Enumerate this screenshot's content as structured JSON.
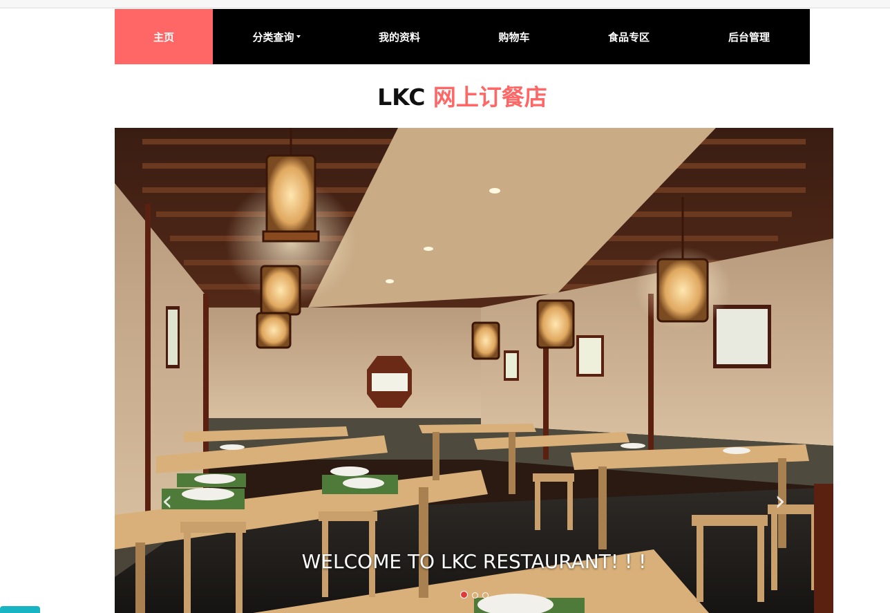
{
  "nav": {
    "items": [
      {
        "label": "主页",
        "active": true
      },
      {
        "label": "分类查询",
        "dropdown": true
      },
      {
        "label": "我的资料"
      },
      {
        "label": "购物车"
      },
      {
        "label": "食品专区"
      },
      {
        "label": "后台管理"
      }
    ],
    "active_color": "#ff6666",
    "bg_color": "#000000"
  },
  "title": {
    "brand": "LKC",
    "name": "网上订餐店",
    "name_color": "#ff6666"
  },
  "carousel": {
    "caption": "WELCOME TO LKC RESTAURANT! ! !",
    "prev_icon": "chevron-left-icon",
    "next_icon": "chevron-right-icon",
    "slides_count": 3,
    "active_index": 0,
    "indicator_active_color": "#e03a3a"
  }
}
